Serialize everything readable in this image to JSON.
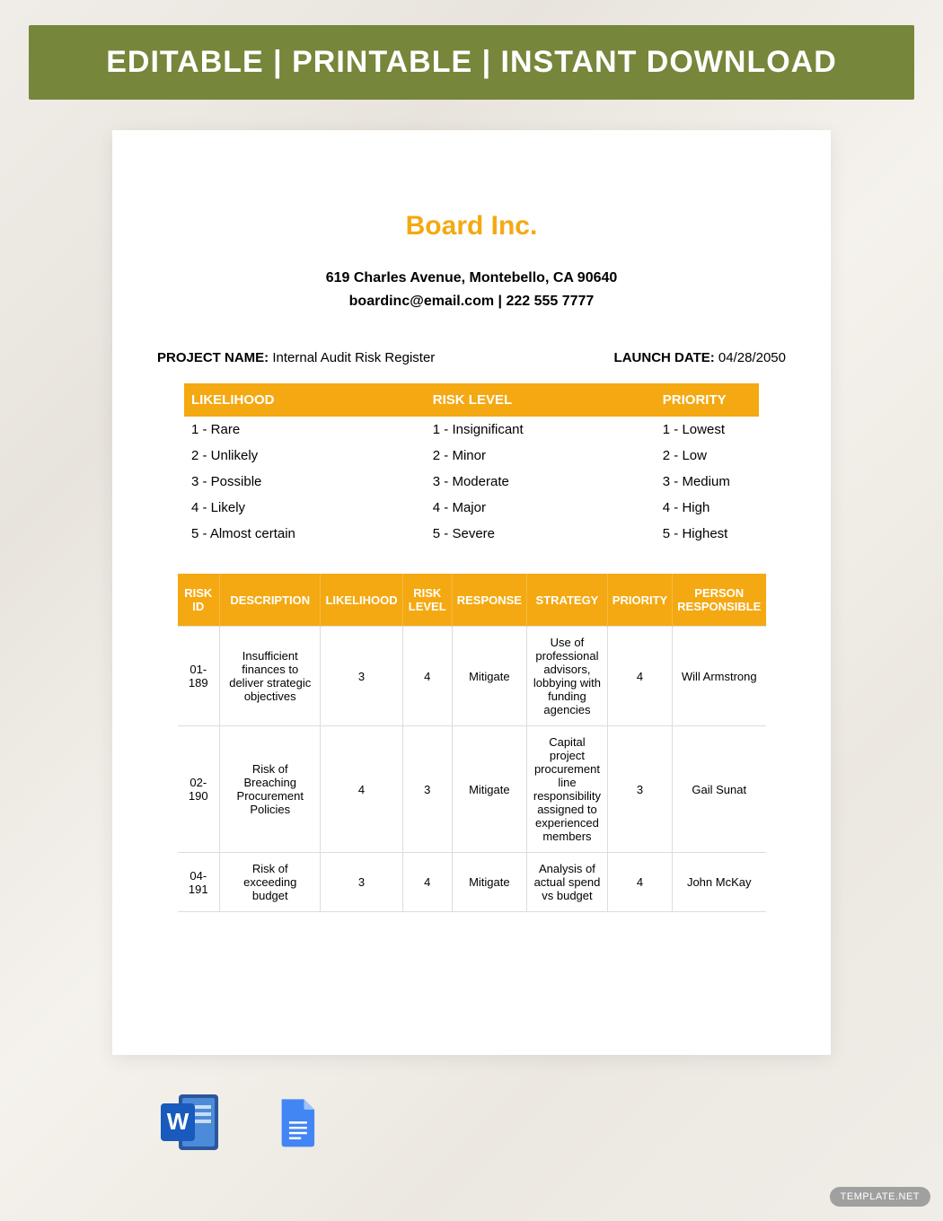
{
  "banner": "EDITABLE  |  PRINTABLE  |  INSTANT DOWNLOAD",
  "company": {
    "name": "Board Inc.",
    "address": "619 Charles Avenue, Montebello, CA 90640",
    "contact": "boardinc@email.com | 222 555 7777"
  },
  "project": {
    "name_label": "PROJECT NAME:",
    "name_value": "Internal Audit Risk Register",
    "launch_label": "LAUNCH DATE:",
    "launch_value": "04/28/2050"
  },
  "legend": {
    "headers": {
      "likelihood": "LIKELIHOOD",
      "risk_level": "RISK LEVEL",
      "priority": "PRIORITY"
    },
    "rows": [
      {
        "l": "1 - Rare",
        "r": "1 - Insignificant",
        "p": "1 - Lowest"
      },
      {
        "l": "2 - Unlikely",
        "r": "2 - Minor",
        "p": "2 - Low"
      },
      {
        "l": "3 - Possible",
        "r": "3 - Moderate",
        "p": "3 - Medium"
      },
      {
        "l": "4 - Likely",
        "r": "4 - Major",
        "p": "4 - High"
      },
      {
        "l": "5 - Almost certain",
        "r": "5 - Severe",
        "p": "5 - Highest"
      }
    ]
  },
  "risk_table": {
    "headers": {
      "risk_id": "RISK ID",
      "description": "DESCRIPTION",
      "likelihood": "LIKELIHOOD",
      "risk_level": "RISK LEVEL",
      "response": "RESPONSE",
      "strategy": "STRATEGY",
      "priority": "PRIORITY",
      "person": "PERSON RESPONSIBLE"
    },
    "rows": [
      {
        "risk_id": "01-189",
        "description": "Insufficient finances to deliver strategic objectives",
        "likelihood": "3",
        "risk_level": "4",
        "response": "Mitigate",
        "strategy": "Use of professional advisors, lobbying with funding agencies",
        "priority": "4",
        "person": "Will Armstrong"
      },
      {
        "risk_id": "02-190",
        "description": "Risk of Breaching Procurement Policies",
        "likelihood": "4",
        "risk_level": "3",
        "response": "Mitigate",
        "strategy": "Capital project procurement line responsibility assigned to experienced members",
        "priority": "3",
        "person": "Gail Sunat"
      },
      {
        "risk_id": "04-191",
        "description": "Risk of exceeding budget",
        "likelihood": "3",
        "risk_level": "4",
        "response": "Mitigate",
        "strategy": "Analysis of actual spend vs budget",
        "priority": "4",
        "person": "John McKay"
      }
    ]
  },
  "watermark": {
    "brand": "TEMPLATE",
    "suffix": ".NET"
  }
}
